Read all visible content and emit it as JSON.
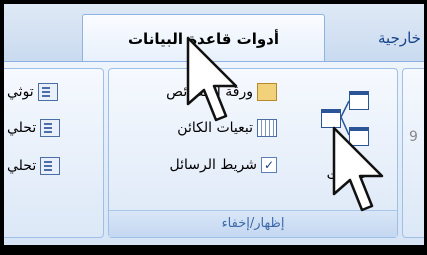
{
  "tabs": {
    "active": "أدوات قاعدة البيانات",
    "right": "ات خارجية"
  },
  "group_show_hide": {
    "label": "إظهار/إخفاء",
    "relationships": "علاقات",
    "property_sheet": "ورقة الخصائص",
    "object_dependencies": "تبعيات الكائن",
    "message_bar": "شريط الرسائل",
    "message_bar_checked": "✓"
  },
  "group_left": {
    "item1": "توثي",
    "item2": "تحلي",
    "item3": "تحلي"
  },
  "group_right": {
    "partial_char": "9"
  }
}
